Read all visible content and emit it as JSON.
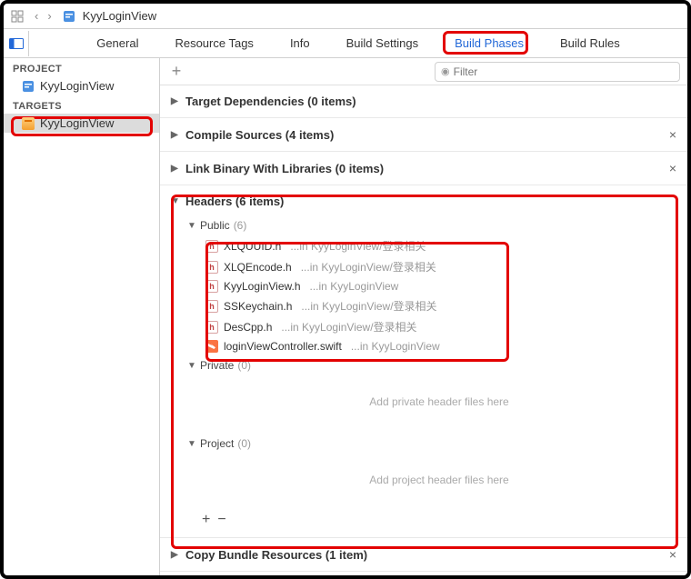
{
  "breadcrumb": {
    "title": "KyyLoginView"
  },
  "tabs": {
    "general": "General",
    "resource_tags": "Resource Tags",
    "info": "Info",
    "build_settings": "Build Settings",
    "build_phases": "Build Phases",
    "build_rules": "Build Rules"
  },
  "sidebar": {
    "project_header": "PROJECT",
    "project": {
      "name": "KyyLoginView"
    },
    "targets_header": "TARGETS",
    "target": {
      "name": "KyyLoginView"
    }
  },
  "filter": {
    "placeholder": "Filter"
  },
  "phases": {
    "target_deps": "Target Dependencies (0 items)",
    "compile_sources": "Compile Sources (4 items)",
    "link_binary": "Link Binary With Libraries (0 items)",
    "headers": "Headers (6 items)",
    "copy_bundle": "Copy Bundle Resources (1 item)"
  },
  "headers_section": {
    "public_label": "Public",
    "public_count": "(6)",
    "private_label": "Private",
    "private_count": "(0)",
    "project_label": "Project",
    "project_count": "(0)",
    "private_placeholder": "Add private header files here",
    "project_placeholder": "Add project header files here",
    "files": [
      {
        "name": "XLQUUID.h",
        "path": "...in KyyLoginView/登录相关",
        "kind": "h"
      },
      {
        "name": "XLQEncode.h",
        "path": "...in KyyLoginView/登录相关",
        "kind": "h"
      },
      {
        "name": "KyyLoginView.h",
        "path": "...in KyyLoginView",
        "kind": "h"
      },
      {
        "name": "SSKeychain.h",
        "path": "...in KyyLoginView/登录相关",
        "kind": "h"
      },
      {
        "name": "DesCpp.h",
        "path": "...in KyyLoginView/登录相关",
        "kind": "h"
      },
      {
        "name": "loginViewController.swift",
        "path": "...in KyyLoginView",
        "kind": "swift"
      }
    ]
  }
}
